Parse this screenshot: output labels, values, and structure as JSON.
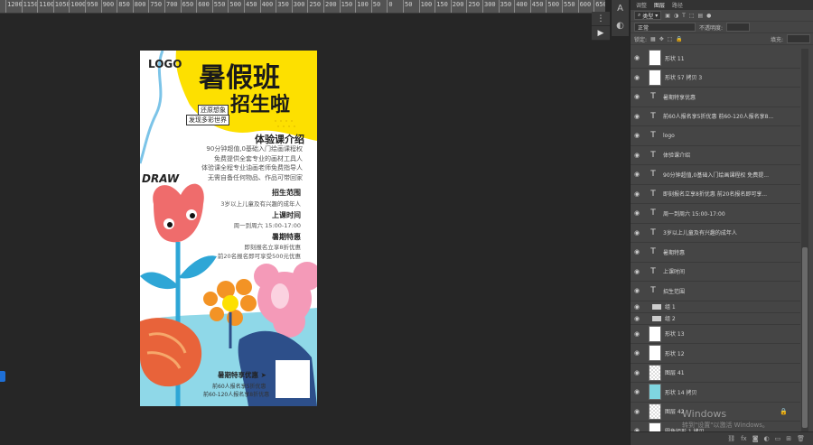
{
  "ruler": {
    "labels": [
      "1200",
      "1150",
      "1100",
      "1050",
      "1000",
      "950",
      "900",
      "850",
      "800",
      "750",
      "700",
      "650",
      "600",
      "550",
      "500",
      "450",
      "400",
      "350",
      "300",
      "250",
      "200",
      "150",
      "100",
      "50",
      "0",
      "50",
      "100",
      "150",
      "200",
      "250",
      "300",
      "350",
      "400",
      "450",
      "500",
      "550",
      "600",
      "650"
    ]
  },
  "poster": {
    "logo": "LOGO",
    "headline_1": "暑假班",
    "headline_2": "招生啦",
    "tag_1": "还原想象",
    "tag_2": "发现多彩世界",
    "section_title": "体验课介绍",
    "intro_lines": [
      "90分钟超值,0基础入门绘画课程权",
      "免费提供全套专业的画材工具人",
      "体验课全程专业油画老师免费指导人",
      "无需自备任何物品、作品可带回家"
    ],
    "draw_word": "DRAW",
    "range_title": "招生范围",
    "range_text": "3岁以上儿童及有兴趣的成年人",
    "time_title": "上课时间",
    "time_text": "周一到周六  15:00-17:00",
    "discount_title": "暑期特惠",
    "discount_line_1": "即刻报名立享8折优惠",
    "discount_line_2": "前20名报名即可享受500元优惠",
    "bottom_title": "暑期特享优惠 ➤",
    "bottom_line_1": "前60人报名享5折优惠",
    "bottom_line_2": "前60-120人报名享8折优惠"
  },
  "panel": {
    "tabs": [
      "调整",
      "图层",
      "路径"
    ],
    "filter_label": "类型",
    "blend_mode": "正常",
    "opacity_label": "不透明度:",
    "lock_label": "锁定:",
    "fill_label": "填充:",
    "layers": [
      {
        "kind": "shape",
        "name": "形状 11"
      },
      {
        "kind": "shape",
        "name": "形状 57 拷贝 3"
      },
      {
        "kind": "text",
        "name": "暑期特享优惠"
      },
      {
        "kind": "text",
        "name": "前60人报名享5折优惠  前60-120人报名享8..."
      },
      {
        "kind": "text",
        "name": "logo"
      },
      {
        "kind": "text",
        "name": "体验课介绍"
      },
      {
        "kind": "text",
        "name": "90分钟超值,0基础入门绘画课程权 免费提..."
      },
      {
        "kind": "text",
        "name": "即刻报名立享8折优惠  前20名报名即可享..."
      },
      {
        "kind": "text",
        "name": "周一到周六  15:00-17:00"
      },
      {
        "kind": "text",
        "name": "3岁以上儿童及有兴趣的成年人"
      },
      {
        "kind": "text",
        "name": "暑期特惠"
      },
      {
        "kind": "text",
        "name": "上课时间"
      },
      {
        "kind": "text",
        "name": "招生范围"
      },
      {
        "kind": "group",
        "name": "组 1"
      },
      {
        "kind": "group",
        "name": "组 2"
      },
      {
        "kind": "shape",
        "name": "形状 13"
      },
      {
        "kind": "shape",
        "name": "形状 12"
      },
      {
        "kind": "pixel",
        "name": "图层 41"
      },
      {
        "kind": "cyan",
        "name": "形状 14 拷贝"
      },
      {
        "kind": "pixel",
        "name": "图层 42",
        "locked": true
      },
      {
        "kind": "shape",
        "name": "圆角矩形 1 拷贝"
      }
    ]
  },
  "watermark": {
    "line1": "Windows",
    "line2": "转到\"设置\"以激活 Windows。"
  }
}
